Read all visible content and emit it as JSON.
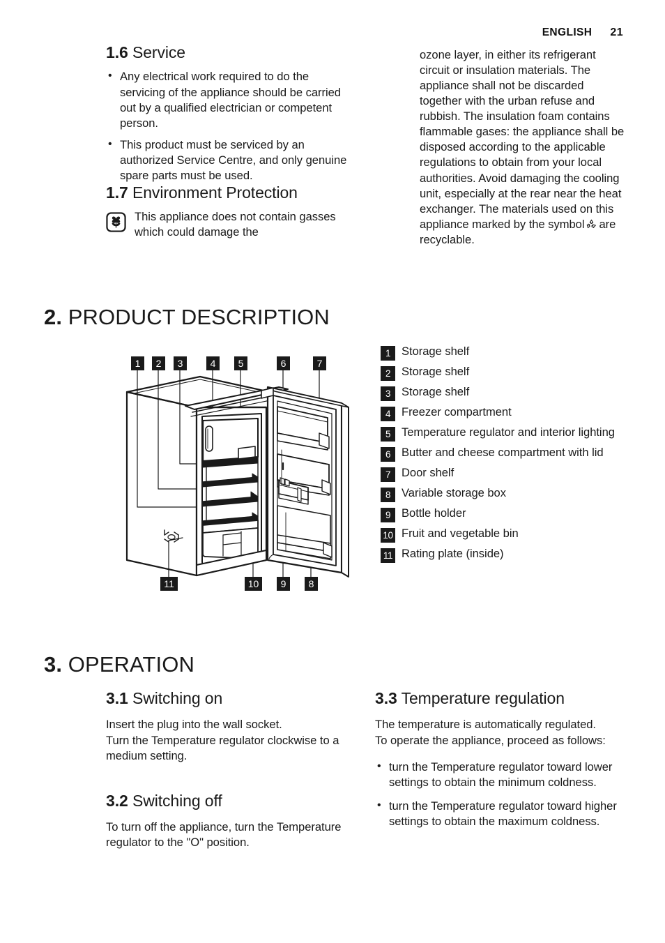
{
  "header": {
    "language": "ENGLISH",
    "page_number": "21"
  },
  "section_1_6": {
    "number": "1.6",
    "title": "Service",
    "bullets": [
      "Any electrical work required to do the servicing of the appliance should be carried out by a qualified electrician or competent person.",
      "This product must be serviced by an authorized Service Centre, and only genuine spare parts must be used."
    ]
  },
  "section_1_7": {
    "number": "1.7",
    "title": "Environment Protection",
    "icon": "flower-icon",
    "text_left": "This appliance does not contain gasses which could damage the",
    "text_right_before_symbol": "ozone layer, in either its refrigerant circuit or insulation materials. The appliance shall not be discarded together with the urban refuse and rubbish. The insulation foam contains flammable gases: the appliance shall be disposed according to the applicable regulations to obtain from your local authorities. Avoid damaging the cooling unit, especially at the rear near the heat exchanger. The materials used on this appliance marked by the symbol",
    "symbol": "recycle-icon",
    "text_right_after_symbol": "are recyclable."
  },
  "chapter_2": {
    "number": "2.",
    "title": "PRODUCT DESCRIPTION",
    "diagram": {
      "name": "refrigerator-cutaway-diagram",
      "callouts_top": [
        "1",
        "2",
        "3",
        "4",
        "5",
        "6",
        "7"
      ],
      "callouts_bottom": [
        "11",
        "10",
        "9",
        "8"
      ]
    },
    "legend": [
      {
        "num": "1",
        "label": "Storage shelf"
      },
      {
        "num": "2",
        "label": "Storage shelf"
      },
      {
        "num": "3",
        "label": "Storage shelf"
      },
      {
        "num": "4",
        "label": "Freezer compartment"
      },
      {
        "num": "5",
        "label": "Temperature regulator and interior lighting"
      },
      {
        "num": "6",
        "label": "Butter and cheese compartment with lid"
      },
      {
        "num": "7",
        "label": "Door shelf"
      },
      {
        "num": "8",
        "label": "Variable storage box"
      },
      {
        "num": "9",
        "label": "Bottle holder"
      },
      {
        "num": "10",
        "label": "Fruit and vegetable bin"
      },
      {
        "num": "11",
        "label": "Rating plate (inside)"
      }
    ]
  },
  "chapter_3": {
    "number": "3.",
    "title": "OPERATION",
    "section_3_1": {
      "number": "3.1",
      "title": "Switching on",
      "body": "Insert the plug into the wall socket.\nTurn the Temperature regulator clockwise to a medium setting."
    },
    "section_3_2": {
      "number": "3.2",
      "title": "Switching off",
      "body": "To turn off the appliance, turn the Temperature regulator to the \"O\" position."
    },
    "section_3_3": {
      "number": "3.3",
      "title": "Temperature regulation",
      "body": "The temperature is automatically regulated.\nTo operate the appliance, proceed as follows:",
      "bullets": [
        "turn the Temperature regulator toward lower settings to obtain the minimum coldness.",
        "turn the Temperature regulator toward higher settings to obtain the maximum coldness."
      ]
    }
  },
  "colors": {
    "text": "#1a1a1a",
    "badge_background": "#1a1a1a",
    "badge_text": "#ffffff",
    "page_background": "#ffffff"
  }
}
